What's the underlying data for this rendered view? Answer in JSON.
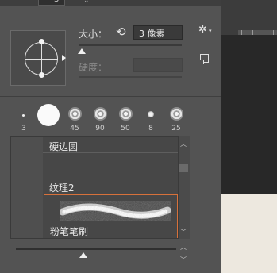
{
  "options_bar": {
    "value": "3",
    "chevron": "⌄"
  },
  "brush_panel": {
    "size_label": "大小：",
    "size_value": "3 像素",
    "size_level": 0.02,
    "hardness_label": "硬度：",
    "hardness_value": "",
    "icons": {
      "reset": "reset-icon",
      "gear": "gear-icon",
      "new_preset": "new-preset-icon",
      "angle": "angle-roundness-icon"
    },
    "glyphs": {
      "reset": "⟲",
      "gear": "✲",
      "gear_caret": "▾",
      "up": "︿",
      "down": "﹀"
    }
  },
  "recent_brushes": [
    {
      "label": "3",
      "kind": "dot"
    },
    {
      "label": "",
      "kind": "hard-round"
    },
    {
      "label": "45",
      "kind": "textured"
    },
    {
      "label": "90",
      "kind": "textured"
    },
    {
      "label": "50",
      "kind": "textured"
    },
    {
      "label": "8",
      "kind": "small-soft"
    },
    {
      "label": "25",
      "kind": "textured"
    }
  ],
  "brush_list": {
    "items": [
      {
        "name": "硬边圆",
        "selected": false
      },
      {
        "name": "纹理2",
        "selected": false
      },
      {
        "name": "粉笔笔刷",
        "selected": true
      }
    ]
  },
  "preview_scale_level": 0.42,
  "colors": {
    "selection_border": "#d7713b",
    "panel_bg": "#535353"
  }
}
